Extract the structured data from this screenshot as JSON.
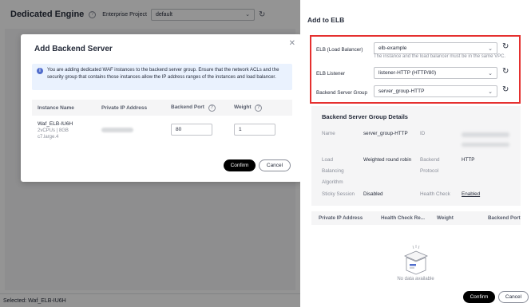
{
  "page": {
    "title": "Dedicated Engine",
    "enterprise_project_label": "Enterprise Project",
    "enterprise_project_value": "default",
    "footer_selected": "Selected: Waf_ELB-IU6H"
  },
  "modal": {
    "title": "Add Backend Server",
    "info": "You are adding dedicated WAF instances to the backend server group. Ensure that the network ACLs and the security group that contains those instances allow the IP address ranges of the instances and load balancer.",
    "columns": [
      "Instance Name",
      "Private IP Address",
      "Backend Port",
      "Weight"
    ],
    "row": {
      "instance_name": "Waf_ELB-IU6H",
      "spec_line1": "2vCPUs | 8GB",
      "spec_line2": "c7.large.4",
      "backend_port": "80",
      "weight": "1"
    },
    "confirm_label": "Confirm",
    "cancel_label": "Cancel"
  },
  "drawer": {
    "title": "Add to ELB",
    "elb_label": "ELB (Load Balancer)",
    "elb_value": "elb-example",
    "elb_hint": "The instance and the load balancer must be in the same VPC.",
    "listener_label": "ELB Listener",
    "listener_value": "listener-HTTP (HTTP/80)",
    "group_label": "Backend Server Group",
    "group_value": "server_group-HTTP",
    "details": {
      "title": "Backend Server Group Details",
      "name_label": "Name",
      "name_value": "server_group-HTTP",
      "id_label": "ID",
      "lb_label_1": "Load",
      "lb_label_2": "Balancing",
      "lb_label_3": "Algorithm",
      "lb_value": "Weighted round robin",
      "backend_label_1": "Backend",
      "backend_label_2": "Protocol",
      "backend_value": "HTTP",
      "sticky_label": "Sticky Session",
      "sticky_value": "Disabled",
      "health_label": "Health Check",
      "health_value": "Enabled"
    },
    "table_columns": [
      "Private IP Address",
      "Health Check Re...",
      "Weight",
      "Backend Port"
    ],
    "no_data": "No data available",
    "confirm_label": "Confirm",
    "cancel_label": "Cancel"
  },
  "colors": {
    "highlight_border": "#e5302f",
    "primary_button": "#000000",
    "info_background": "#eaf2fe",
    "info_icon": "#526ecc"
  }
}
